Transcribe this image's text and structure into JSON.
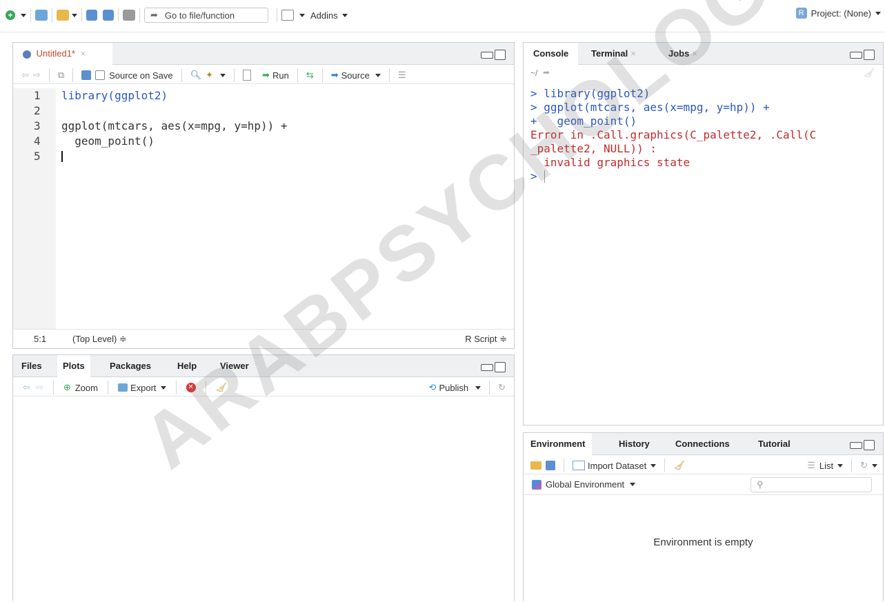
{
  "toolbar": {
    "goto_placeholder": "Go to file/function",
    "addins_label": "Addins",
    "project_label": "Project: (None)"
  },
  "editor": {
    "tab_title": "Untitled1*",
    "source_on_save": "Source on Save",
    "run_label": "Run",
    "source_label": "Source",
    "lines": [
      {
        "num": "1",
        "text": "library(ggplot2)"
      },
      {
        "num": "2",
        "text": ""
      },
      {
        "num": "3",
        "text": "ggplot(mtcars, aes(x=mpg, y=hp)) +"
      },
      {
        "num": "4",
        "text": "  geom_point()"
      },
      {
        "num": "5",
        "text": ""
      }
    ],
    "status_position": "5:1",
    "status_scope": "(Top Level) ≑",
    "status_type": "R Script ≑"
  },
  "console": {
    "tabs": [
      "Console",
      "Terminal",
      "Jobs"
    ],
    "path": "~/",
    "lines": [
      {
        "kind": "cmd",
        "text": "> library(ggplot2)"
      },
      {
        "kind": "cmd",
        "text": "> ggplot(mtcars, aes(x=mpg, y=hp)) +"
      },
      {
        "kind": "cmd",
        "text": "+   geom_point()"
      },
      {
        "kind": "err",
        "text": "Error in .Call.graphics(C_palette2, .Call(C"
      },
      {
        "kind": "err",
        "text": "_palette2, NULL)) :"
      },
      {
        "kind": "err",
        "text": "  invalid graphics state"
      }
    ],
    "prompt": ">"
  },
  "files_pane": {
    "tabs": [
      "Files",
      "Plots",
      "Packages",
      "Help",
      "Viewer"
    ],
    "zoom_label": "Zoom",
    "export_label": "Export",
    "publish_label": "Publish"
  },
  "env_pane": {
    "tabs": [
      "Environment",
      "History",
      "Connections",
      "Tutorial"
    ],
    "import_label": "Import Dataset",
    "list_label": "List",
    "scope_label": "Global Environment",
    "empty_message": "Environment is empty"
  },
  "watermark": "ARABPSYCHOLOGY",
  "colors": {
    "code_blue": "#2b57c0",
    "error_red": "#c52a2a",
    "tab_bg": "#eef0f2"
  }
}
